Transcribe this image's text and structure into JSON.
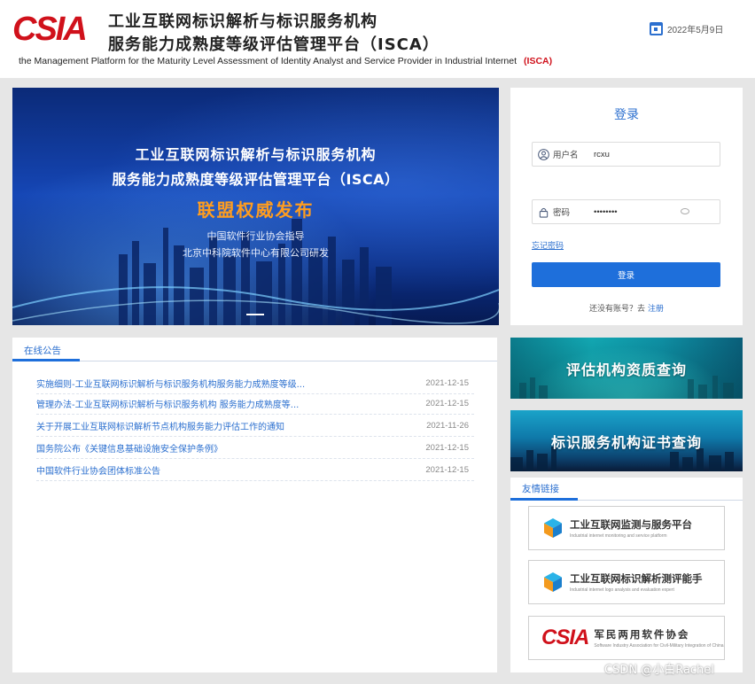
{
  "header": {
    "logo_text": "CSIA",
    "title_line1": "工业互联网标识解析与标识服务机构",
    "title_line2": "服务能力成熟度等级评估管理平台（ISCA）",
    "title_en": "the Management Platform for the Maturity Level Assessment of Identity Analyst and Service Provider in Industrial Internet",
    "title_en_suffix": "(ISCA)",
    "date": "2022年5月9日"
  },
  "banner": {
    "line1": "工业互联网标识解析与标识服务机构",
    "line2": "服务能力成熟度等级评估管理平台（ISCA）",
    "highlight": "联盟权威发布",
    "sub1": "中国软件行业协会指导",
    "sub2": "北京中科院软件中心有限公司研发"
  },
  "login": {
    "title": "登录",
    "username_label": "用户名",
    "username_value": "rcxu",
    "password_label": "密码",
    "password_value": "••••••••",
    "forgot": "忘记密码",
    "submit": "登录",
    "no_account": "还没有账号？去",
    "register": "注册"
  },
  "notice": {
    "tab": "在线公告",
    "items": [
      {
        "title": "实施细则-工业互联网标识解析与标识服务机构服务能力成熟度等级...",
        "date": "2021-12-15"
      },
      {
        "title": "管理办法-工业互联网标识解析与标识服务机构 服务能力成熟度等...",
        "date": "2021-12-15"
      },
      {
        "title": "关于开展工业互联网标识解析节点机构服务能力评估工作的通知",
        "date": "2021-11-26"
      },
      {
        "title": "国务院公布《关键信息基础设施安全保护条例》",
        "date": "2021-12-15"
      },
      {
        "title": "中国软件行业协会团体标准公告",
        "date": "2021-12-15"
      }
    ]
  },
  "query": {
    "qualification": "评估机构资质查询",
    "certificate": "标识服务机构证书查询"
  },
  "friends": {
    "tab": "友情链接",
    "links": [
      {
        "title": "工业互联网监测与服务平台",
        "subtitle": "Industrial internet monitoring and service platform"
      },
      {
        "title": "工业互联网标识解析测评能手",
        "subtitle": "Industrial internet logo analysis and evaluation expert"
      },
      {
        "logo": "CSIA",
        "title": "军民两用软件协会",
        "subtitle": "Software Industry Association for Civil-Military Integration of China"
      }
    ]
  },
  "watermark": "CSDN @小白Rachel",
  "colors": {
    "brand_red": "#d0111b",
    "primary_blue": "#1e6fdb"
  }
}
